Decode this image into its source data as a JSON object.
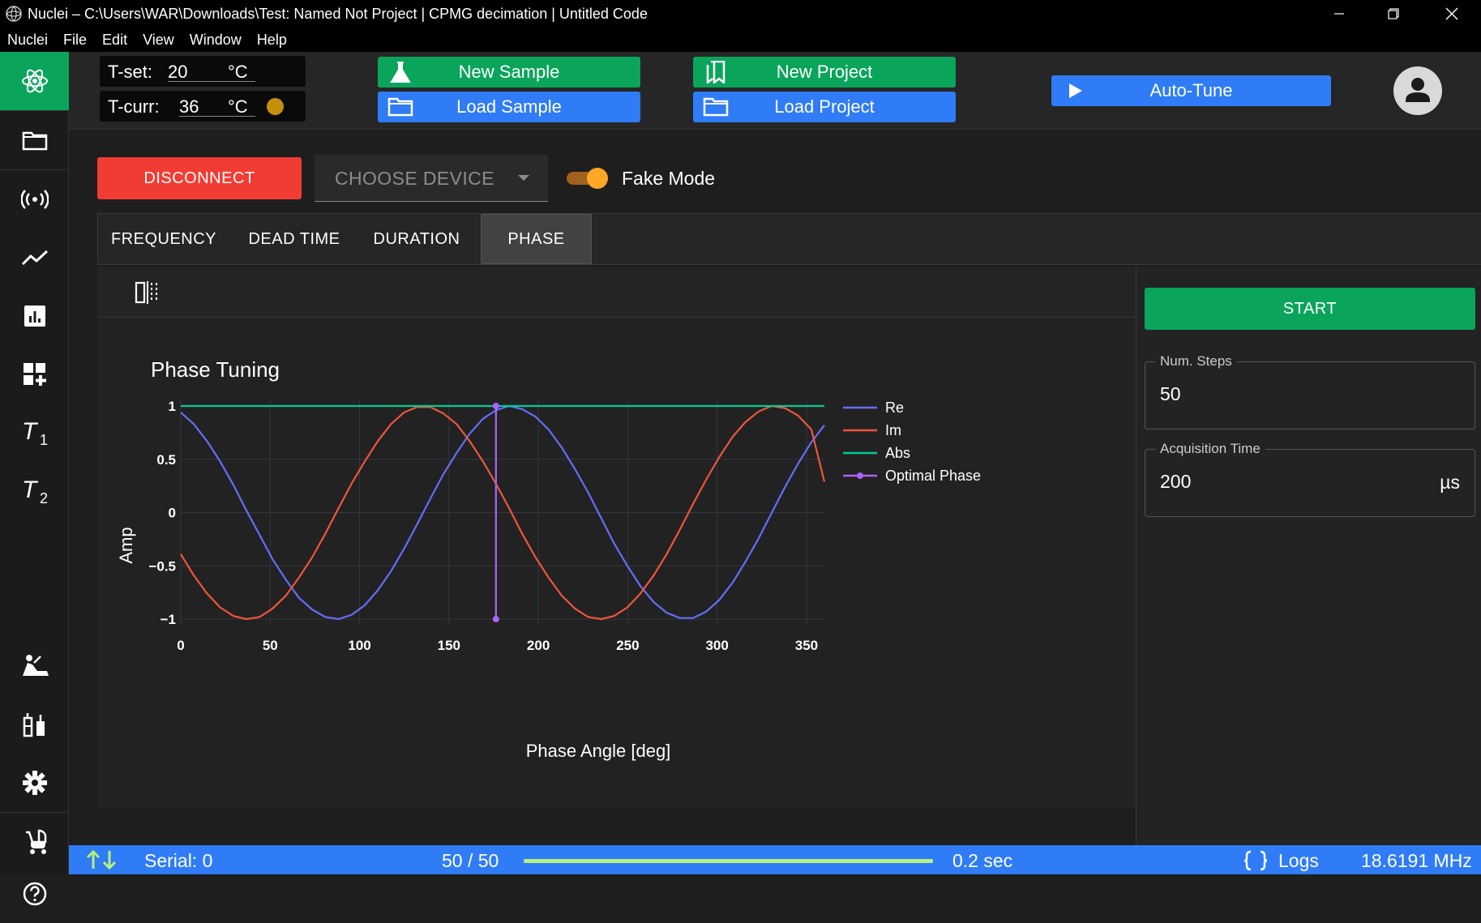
{
  "window": {
    "title": "Nuclei – C:\\Users\\WAR\\Downloads\\Test: Named Not Project | CPMG decimation | Untitled Code"
  },
  "menu": [
    "Nuclei",
    "File",
    "Edit",
    "View",
    "Window",
    "Help"
  ],
  "sidebar": {
    "icons": [
      "nuclei-logo-icon",
      "folder-icon",
      "broadcast-icon",
      "line-chart-icon",
      "bar-chart-icon",
      "dashboard-add-icon",
      "t1-icon",
      "t2-icon",
      "sample-icon",
      "vials-icon",
      "gear-icon",
      "stroller-icon",
      "help-icon"
    ],
    "t1_label": "T",
    "t1_sub": "1",
    "t2_label": "T",
    "t2_sub": "2"
  },
  "temps": {
    "set_label": "T-set:",
    "set_value": "20",
    "set_unit": "°C",
    "curr_label": "T-curr:",
    "curr_value": "36",
    "curr_unit": "°C",
    "status_color": "#c4900c"
  },
  "topbar": {
    "new_sample": "New Sample",
    "new_project": "New Project",
    "load_sample": "Load Sample",
    "load_project": "Load Project",
    "auto_tune": "Auto-Tune"
  },
  "controls": {
    "disconnect": "DISCONNECT",
    "choose_device": "CHOOSE DEVICE",
    "fake_mode": "Fake Mode",
    "fake_mode_on": true
  },
  "tabs": [
    "FREQUENCY",
    "DEAD TIME",
    "DURATION",
    "PHASE"
  ],
  "active_tab": "PHASE",
  "right_panel": {
    "start": "START",
    "num_steps_label": "Num. Steps",
    "num_steps_value": "50",
    "acq_time_label": "Acquisition Time",
    "acq_time_value": "200",
    "acq_time_unit": "µs"
  },
  "status": {
    "serial": "Serial: 0",
    "progress_text": "50 / 50",
    "progress_fraction": 1.0,
    "elapsed": "0.2 sec",
    "logs": "Logs",
    "frequency": "18.6191 MHz"
  },
  "colors": {
    "accent_green": "#0aa55b",
    "accent_blue": "#2f7cf6",
    "danger_red": "#f13c33",
    "toggle_orange": "#ffa726"
  },
  "chart_data": {
    "type": "line",
    "title": "Phase Tuning",
    "xlabel": "Phase Angle [deg]",
    "ylabel": "Amp",
    "xlim": [
      0,
      360
    ],
    "ylim": [
      -1.1,
      1.1
    ],
    "xticks": [
      0,
      50,
      100,
      150,
      200,
      250,
      300,
      350
    ],
    "yticks": [
      1,
      0.5,
      0,
      -0.5,
      -1
    ],
    "ytick_labels": [
      "1",
      "0.5",
      "0",
      "−0.5",
      "−1"
    ],
    "grid": true,
    "legend_placement": "right",
    "series": [
      {
        "name": "Re",
        "color": "#636efa",
        "x": [
          0,
          7.3,
          14.7,
          22,
          29.4,
          36.7,
          44.1,
          51.4,
          58.8,
          66.1,
          73.5,
          80.8,
          88.2,
          95.5,
          102.9,
          110.2,
          117.6,
          124.9,
          132.2,
          139.6,
          146.9,
          154.3,
          161.6,
          169,
          176.3,
          183.7,
          191,
          198.4,
          205.7,
          213.1,
          220.4,
          227.8,
          235.1,
          242.4,
          249.8,
          257.1,
          264.5,
          271.8,
          279.2,
          286.5,
          293.9,
          301.2,
          308.6,
          315.9,
          323.3,
          330.6,
          338,
          345.3,
          352.7,
          360
        ],
        "y": [
          0.94,
          0.83,
          0.67,
          0.48,
          0.26,
          0.02,
          -0.21,
          -0.44,
          -0.63,
          -0.8,
          -0.91,
          -0.98,
          -1.0,
          -0.96,
          -0.87,
          -0.73,
          -0.55,
          -0.34,
          -0.11,
          0.13,
          0.36,
          0.56,
          0.74,
          0.88,
          0.96,
          1.0,
          0.97,
          0.9,
          0.78,
          0.61,
          0.41,
          0.19,
          -0.05,
          -0.29,
          -0.5,
          -0.69,
          -0.84,
          -0.94,
          -0.99,
          -0.99,
          -0.93,
          -0.82,
          -0.66,
          -0.46,
          -0.24,
          0.0,
          0.24,
          0.46,
          0.66,
          0.82
        ]
      },
      {
        "name": "Im",
        "color": "#ef553b",
        "x": [
          0,
          7.3,
          14.7,
          22,
          29.4,
          36.7,
          44.1,
          51.4,
          58.8,
          66.1,
          73.5,
          80.8,
          88.2,
          95.5,
          102.9,
          110.2,
          117.6,
          124.9,
          132.2,
          139.6,
          146.9,
          154.3,
          161.6,
          169,
          176.3,
          183.7,
          191,
          198.4,
          205.7,
          213.1,
          220.4,
          227.8,
          235.1,
          242.4,
          249.8,
          257.1,
          264.5,
          271.8,
          279.2,
          286.5,
          293.9,
          301.2,
          308.6,
          315.9,
          323.3,
          330.6,
          338,
          345.3,
          352.7,
          360
        ],
        "y": [
          -0.39,
          -0.59,
          -0.76,
          -0.89,
          -0.97,
          -1.0,
          -0.98,
          -0.9,
          -0.78,
          -0.61,
          -0.42,
          -0.2,
          0.04,
          0.27,
          0.48,
          0.67,
          0.83,
          0.94,
          0.99,
          0.99,
          0.93,
          0.83,
          0.67,
          0.48,
          0.27,
          0.04,
          -0.2,
          -0.42,
          -0.61,
          -0.78,
          -0.9,
          -0.98,
          -1.0,
          -0.97,
          -0.89,
          -0.76,
          -0.59,
          -0.39,
          -0.16,
          0.08,
          0.31,
          0.52,
          0.71,
          0.85,
          0.95,
          1.0,
          0.98,
          0.91,
          0.78,
          0.29
        ]
      },
      {
        "name": "Abs",
        "color": "#00cc96",
        "x": [
          0,
          360
        ],
        "y": [
          1,
          1
        ]
      },
      {
        "name": "Optimal Phase",
        "color": "#ab63fa",
        "x": [
          176.3,
          176.3
        ],
        "y": [
          1,
          -1
        ],
        "markers": true
      }
    ]
  }
}
